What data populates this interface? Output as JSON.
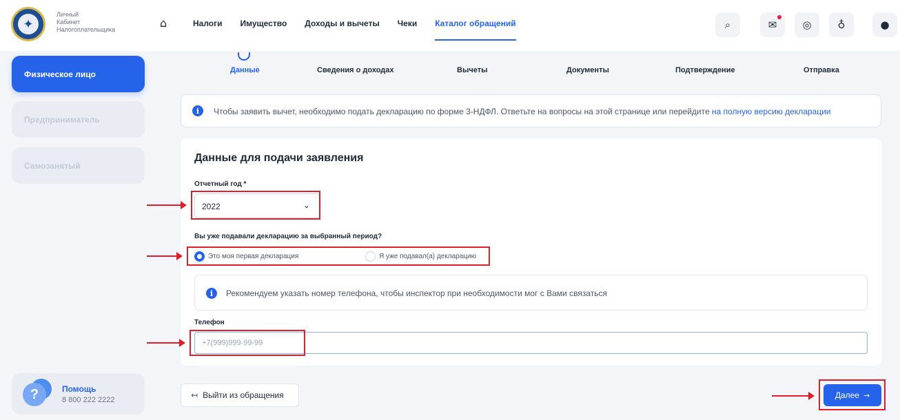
{
  "header": {
    "logo_lines": [
      "Личный",
      "Кабинет",
      "Налогоплательщика"
    ],
    "nav": [
      {
        "label": "Налоги",
        "active": false
      },
      {
        "label": "Имущество",
        "active": false
      },
      {
        "label": "Доходы и вычеты",
        "active": false
      },
      {
        "label": "Чеки",
        "active": false
      },
      {
        "label": "Каталог обращений",
        "active": true
      }
    ],
    "icons": [
      "search-icon",
      "mail-icon",
      "eye-off-icon",
      "lightbulb-icon",
      "user-icon"
    ]
  },
  "sidebar": {
    "items": [
      {
        "label": "Физическое лицо",
        "active": true
      },
      {
        "label": "Предприниматель",
        "active": false
      },
      {
        "label": "Самозанятый",
        "active": false
      }
    ],
    "help": {
      "title": "Помощь",
      "phone": "8 800 222 2222"
    }
  },
  "steps": [
    {
      "label": "Данные",
      "active": true
    },
    {
      "label": "Сведения о доходах",
      "active": false
    },
    {
      "label": "Вычеты",
      "active": false
    },
    {
      "label": "Документы",
      "active": false
    },
    {
      "label": "Подтверждение",
      "active": false
    },
    {
      "label": "Отправка",
      "active": false
    }
  ],
  "info_banner": {
    "text": "Чтобы заявить вычет, необходимо подать декларацию по форме 3-НДФЛ. Ответьте на вопросы на этой странице или перейдите ",
    "link": "на полную версию декларации"
  },
  "form": {
    "title": "Данные для подачи заявления",
    "year_label": "Отчетный год *",
    "year_value": "2022",
    "question": "Вы уже подавали декларацию за выбранный период?",
    "options": [
      {
        "label": "Это моя первая декларация",
        "selected": true
      },
      {
        "label": "Я уже подавал(а) декларацию",
        "selected": false
      }
    ],
    "recommendation": "Рекомендуем указать номер телефона, чтобы инспектор при необходимости мог с Вами связаться",
    "phone_label": "Телефон",
    "phone_placeholder": "+7(999)999-99-99",
    "phone_value": ""
  },
  "actions": {
    "exit_label": "Выйти из обращения",
    "next_label": "Далее"
  },
  "colors": {
    "accent": "#2563eb",
    "annotation": "#e11d2a",
    "background": "#f3f5f9"
  }
}
